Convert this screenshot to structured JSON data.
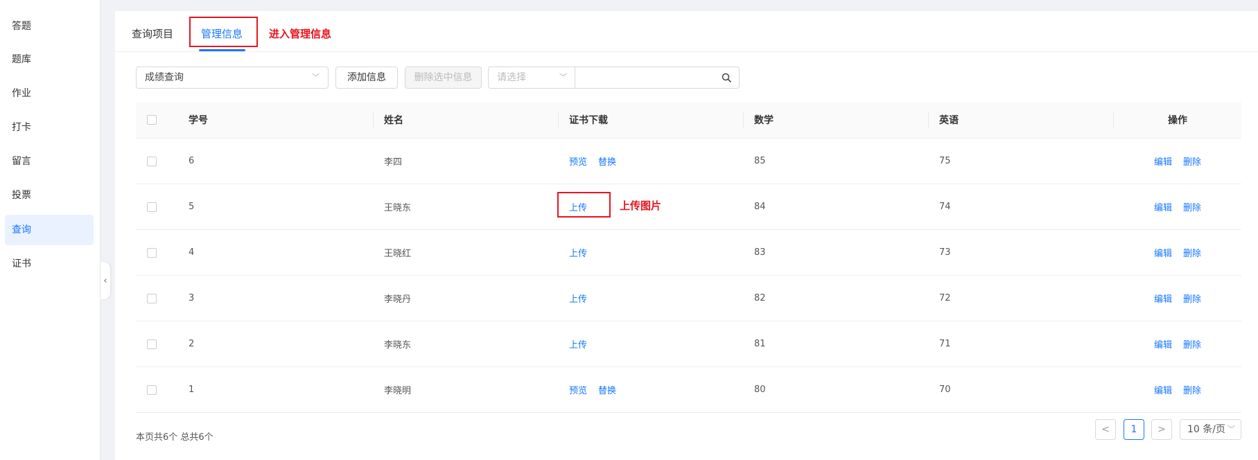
{
  "sidebar": {
    "items": [
      {
        "label": "答题",
        "active": false
      },
      {
        "label": "题库",
        "active": false
      },
      {
        "label": "作业",
        "active": false
      },
      {
        "label": "打卡",
        "active": false
      },
      {
        "label": "留言",
        "active": false
      },
      {
        "label": "投票",
        "active": false
      },
      {
        "label": "查询",
        "active": true
      },
      {
        "label": "证书",
        "active": false
      }
    ],
    "collapse_glyph": "‹"
  },
  "tabs": {
    "query": "查询项目",
    "manage": "管理信息"
  },
  "annotations": {
    "enter_manage": "进入管理信息",
    "upload_image": "上传图片"
  },
  "toolbar": {
    "main_select": "成绩查询",
    "add_button": "添加信息",
    "delete_selected_button": "删除选中信息",
    "filter_placeholder": "请选择",
    "search_value": ""
  },
  "table": {
    "headers": {
      "id": "学号",
      "name": "姓名",
      "cert": "证书下载",
      "math": "数学",
      "english": "英语",
      "ops": "操作"
    },
    "rows": [
      {
        "id": "6",
        "name": "李四",
        "cert": [
          "预览",
          "替换"
        ],
        "math": "85",
        "english": "75"
      },
      {
        "id": "5",
        "name": "王晓东",
        "cert": [
          "上传"
        ],
        "math": "84",
        "english": "74"
      },
      {
        "id": "4",
        "name": "王晓红",
        "cert": [
          "上传"
        ],
        "math": "83",
        "english": "73"
      },
      {
        "id": "3",
        "name": "李晓丹",
        "cert": [
          "上传"
        ],
        "math": "82",
        "english": "72"
      },
      {
        "id": "2",
        "name": "李晓东",
        "cert": [
          "上传"
        ],
        "math": "81",
        "english": "71"
      },
      {
        "id": "1",
        "name": "李晓明",
        "cert": [
          "预览",
          "替换"
        ],
        "math": "80",
        "english": "70"
      }
    ],
    "edit_label": "编辑",
    "delete_label": "删除"
  },
  "footer": {
    "summary": "本页共6个 总共6个",
    "prev": "<",
    "page": "1",
    "next": ">",
    "page_size": "10 条/页"
  },
  "colors": {
    "accent": "#1677ff",
    "annotation": "#e8141e"
  }
}
